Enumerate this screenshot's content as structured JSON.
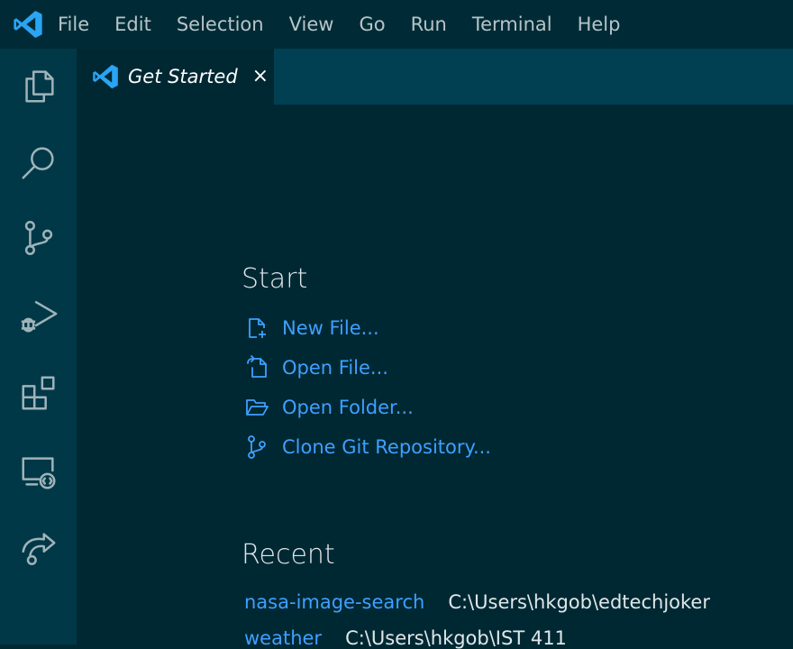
{
  "menu": {
    "items": [
      "File",
      "Edit",
      "Selection",
      "View",
      "Go",
      "Run",
      "Terminal",
      "Help"
    ]
  },
  "activity_bar": {
    "icons": [
      "files-icon",
      "search-icon",
      "source-control-icon",
      "run-debug-icon",
      "extensions-icon",
      "remote-explorer-icon",
      "live-share-icon"
    ]
  },
  "tab": {
    "title": "Get Started",
    "close": "×"
  },
  "start": {
    "title": "Start",
    "actions": [
      {
        "label": "New File...",
        "icon": "new-file-icon"
      },
      {
        "label": "Open File...",
        "icon": "open-file-icon"
      },
      {
        "label": "Open Folder...",
        "icon": "open-folder-icon"
      },
      {
        "label": "Clone Git Repository...",
        "icon": "git-branch-icon"
      }
    ]
  },
  "recent": {
    "title": "Recent",
    "items": [
      {
        "name": "nasa-image-search",
        "path": "C:\\Users\\hkgob\\edtechjoker"
      },
      {
        "name": "weather",
        "path": "C:\\Users\\hkgob\\IST 411"
      }
    ]
  },
  "colors": {
    "background": "#002833",
    "activity_bar": "#003847",
    "tab_bar": "#004052",
    "link": "#3ea0ff",
    "vscode_blue": "#2aa4f4"
  }
}
